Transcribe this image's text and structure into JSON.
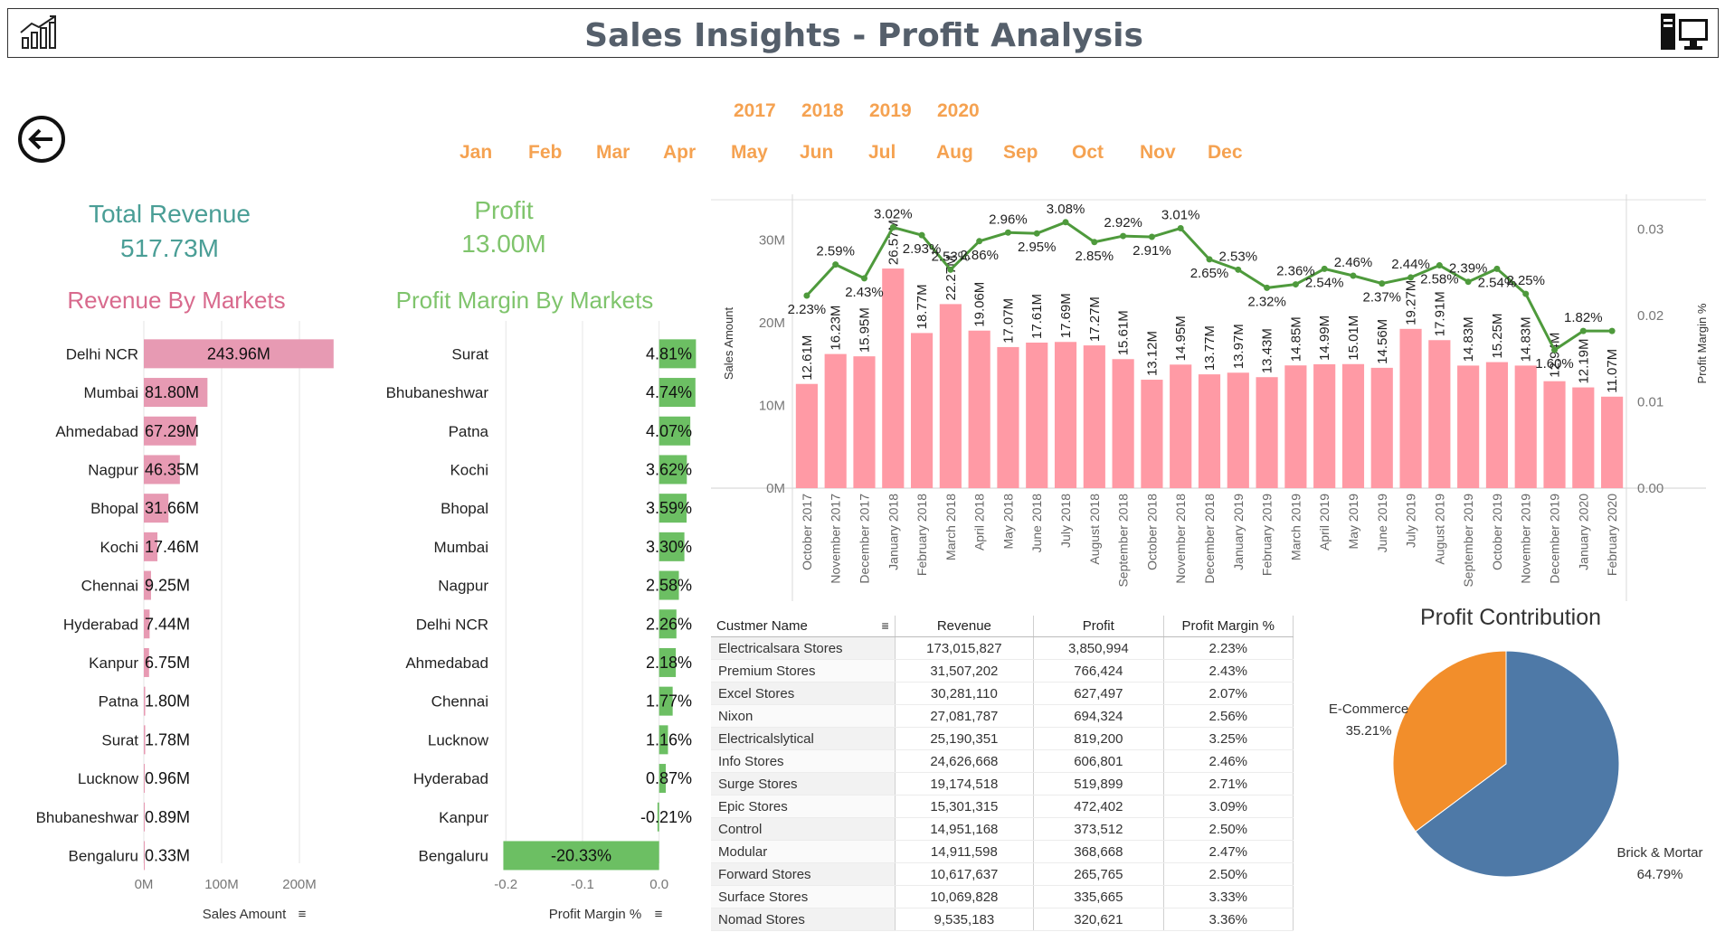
{
  "header": {
    "title": "Sales Insights - Profit Analysis"
  },
  "filters": {
    "years": [
      "2017",
      "2018",
      "2019",
      "2020"
    ],
    "months": [
      "Jan",
      "Feb",
      "Mar",
      "Apr",
      "May",
      "Jun",
      "Jul",
      "Aug",
      "Sep",
      "Oct",
      "Nov",
      "Dec"
    ]
  },
  "kpis": {
    "revenue_label": "Total Revenue",
    "revenue_value": "517.73M",
    "profit_label": "Profit",
    "profit_value": "13.00M"
  },
  "colors": {
    "revenue_bar": "#e79ab3",
    "margin_bar": "#6cbf63",
    "trend_bar": "#ff9aa5",
    "trend_line": "#4e9a3c",
    "teal": "#4a9e96",
    "pink_title": "#d86a8d",
    "green_title": "#7fc46c",
    "pie_brick": "#4e79a7",
    "pie_ecom": "#f28e2b",
    "filter_orange": "#f5a251"
  },
  "icons": {
    "header_left": "bar-chart-growth-icon",
    "header_right": "computer-desktop-icon",
    "back": "back-arrow-icon",
    "sort": "sort-icon"
  },
  "chart_data": [
    {
      "type": "bar",
      "orientation": "horizontal",
      "title": "Revenue By Markets",
      "xlabel": "Sales Amount",
      "categories": [
        "Delhi NCR",
        "Mumbai",
        "Ahmedabad",
        "Nagpur",
        "Bhopal",
        "Kochi",
        "Chennai",
        "Hyderabad",
        "Kanpur",
        "Patna",
        "Surat",
        "Lucknow",
        "Bhubaneshwar",
        "Bengaluru"
      ],
      "values": [
        243.96,
        81.8,
        67.29,
        46.35,
        31.66,
        17.46,
        9.25,
        7.44,
        6.75,
        1.8,
        1.78,
        0.96,
        0.89,
        0.33
      ],
      "labels": [
        "243.96M",
        "81.80M",
        "67.29M",
        "46.35M",
        "31.66M",
        "17.46M",
        "9.25M",
        "7.44M",
        "6.75M",
        "1.80M",
        "1.78M",
        "0.96M",
        "0.89M",
        "0.33M"
      ],
      "xticks": [
        "0M",
        "100M",
        "200M"
      ],
      "xlim": [
        0,
        250
      ]
    },
    {
      "type": "bar",
      "orientation": "horizontal",
      "title": "Profit Margin By Markets",
      "xlabel": "Profit Margin %",
      "categories": [
        "Surat",
        "Bhubaneshwar",
        "Patna",
        "Kochi",
        "Bhopal",
        "Mumbai",
        "Nagpur",
        "Delhi NCR",
        "Ahmedabad",
        "Chennai",
        "Lucknow",
        "Hyderabad",
        "Kanpur",
        "Bengaluru"
      ],
      "values": [
        0.0481,
        0.0474,
        0.0407,
        0.0362,
        0.0359,
        0.033,
        0.0258,
        0.0226,
        0.0218,
        0.0177,
        0.0116,
        0.0087,
        -0.0021,
        -0.2033
      ],
      "labels": [
        "4.81%",
        "4.74%",
        "4.07%",
        "3.62%",
        "3.59%",
        "3.30%",
        "2.58%",
        "2.26%",
        "2.18%",
        "1.77%",
        "1.16%",
        "0.87%",
        "-0.21%",
        "-20.33%"
      ],
      "xticks": [
        "-0.2",
        "-0.1",
        "0.0"
      ],
      "xlim": [
        -0.205,
        0.05
      ]
    },
    {
      "type": "bar+line",
      "yleft_label": "Sales Amount",
      "yright_label": "Profit Margin %",
      "yleft_ticks": [
        "0M",
        "10M",
        "20M",
        "30M"
      ],
      "yright_ticks": [
        "0.00",
        "0.01",
        "0.02",
        "0.03"
      ],
      "ylim_left": [
        0,
        35
      ],
      "ylim_right": [
        0,
        0.0335
      ],
      "categories": [
        "October 2017",
        "November 2017",
        "December 2017",
        "January 2018",
        "February 2018",
        "March 2018",
        "April 2018",
        "May 2018",
        "June 2018",
        "July 2018",
        "August 2018",
        "September 2018",
        "October 2018",
        "November 2018",
        "December 2018",
        "January 2019",
        "February 2019",
        "March 2019",
        "April 2019",
        "May 2019",
        "June 2019",
        "July 2019",
        "August 2019",
        "September 2019",
        "October 2019",
        "November 2019",
        "December 2019",
        "January 2020",
        "February 2020"
      ],
      "bar_values": [
        12.61,
        16.23,
        15.95,
        26.57,
        18.77,
        22.27,
        19.06,
        17.07,
        17.61,
        17.69,
        17.27,
        15.61,
        13.12,
        14.95,
        13.77,
        13.97,
        13.43,
        14.85,
        14.99,
        15.01,
        14.56,
        19.27,
        17.91,
        14.83,
        15.25,
        14.83,
        12.94,
        12.19,
        11.07
      ],
      "bar_labels": [
        "12.61M",
        "16.23M",
        "15.95M",
        "26.57M",
        "18.77M",
        "22.27M",
        "19.06M",
        "17.07M",
        "17.61M",
        "17.69M",
        "17.27M",
        "15.61M",
        "13.12M",
        "14.95M",
        "13.77M",
        "13.97M",
        "13.43M",
        "14.85M",
        "14.99M",
        "15.01M",
        "14.56M",
        "19.27M",
        "17.91M",
        "14.83M",
        "15.25M",
        "14.83M",
        "12.94M",
        "12.19M",
        "11.07M"
      ],
      "line_values": [
        0.0223,
        0.0259,
        0.0243,
        0.0302,
        0.0293,
        0.0253,
        0.0286,
        0.0296,
        0.0295,
        0.0308,
        0.0285,
        0.0292,
        0.0291,
        0.0301,
        0.0265,
        0.0253,
        0.0232,
        0.0236,
        0.0254,
        0.0246,
        0.0237,
        0.0244,
        0.0258,
        0.0239,
        0.0254,
        0.0225,
        0.016,
        0.0182,
        0.0182
      ],
      "line_labels": [
        "2.23%",
        "2.59%",
        "2.43%",
        "3.02%",
        "2.93%",
        "2.53%",
        "2.86%",
        "2.96%",
        "2.95%",
        "3.08%",
        "2.85%",
        "2.92%",
        "2.91%",
        "3.01%",
        "2.65%",
        "2.53%",
        "2.32%",
        "2.36%",
        "2.54%",
        "2.46%",
        "2.37%",
        "2.44%",
        "2.58%",
        "2.39%",
        "2.54%",
        "2.25%",
        "1.60%",
        "1.82%",
        ""
      ]
    },
    {
      "type": "pie",
      "title": "Profit Contribution",
      "slices": [
        {
          "name": "Brick & Mortar",
          "value": 64.79,
          "label": "64.79%"
        },
        {
          "name": "E-Commerce",
          "value": 35.21,
          "label": "35.21%"
        }
      ]
    }
  ],
  "table": {
    "columns": [
      "Custmer Name",
      "Revenue",
      "Profit",
      "Profit Margin %"
    ],
    "rows": [
      [
        "Electricalsara Stores",
        "173,015,827",
        "3,850,994",
        "2.23%"
      ],
      [
        "Premium Stores",
        "31,507,202",
        "766,424",
        "2.43%"
      ],
      [
        "Excel Stores",
        "30,281,110",
        "627,497",
        "2.07%"
      ],
      [
        "Nixon",
        "27,081,787",
        "694,324",
        "2.56%"
      ],
      [
        "Electricalslytical",
        "25,190,351",
        "819,200",
        "3.25%"
      ],
      [
        "Info Stores",
        "24,626,668",
        "606,801",
        "2.46%"
      ],
      [
        "Surge Stores",
        "19,174,518",
        "519,899",
        "2.71%"
      ],
      [
        "Epic Stores",
        "15,301,315",
        "472,402",
        "3.09%"
      ],
      [
        "Control",
        "14,951,168",
        "373,512",
        "2.50%"
      ],
      [
        "Modular",
        "14,911,598",
        "368,668",
        "2.47%"
      ],
      [
        "Forward Stores",
        "10,617,637",
        "265,765",
        "2.50%"
      ],
      [
        "Surface Stores",
        "10,069,828",
        "335,665",
        "3.33%"
      ],
      [
        "Nomad Stores",
        "9,535,183",
        "320,621",
        "3.36%"
      ]
    ]
  }
}
